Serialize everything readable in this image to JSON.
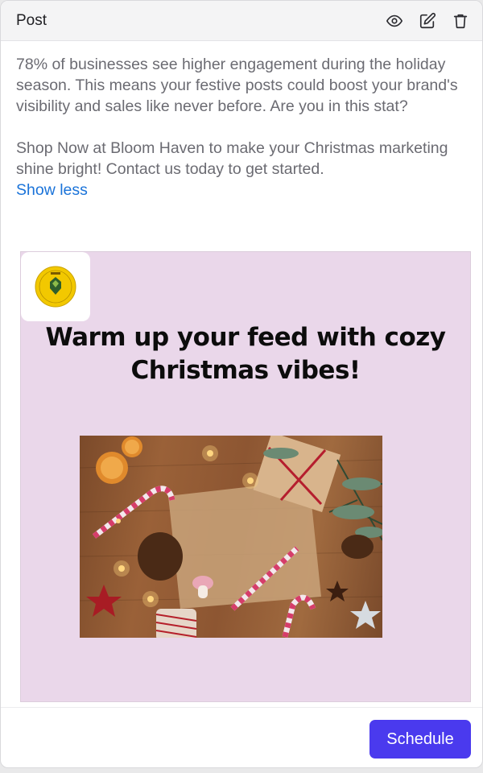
{
  "header": {
    "title": "Post",
    "icons": [
      "eye-icon",
      "edit-icon",
      "trash-icon"
    ]
  },
  "post": {
    "paragraph_1": "78% of businesses see higher engagement during the holiday season. This means your festive posts could boost your brand's visibility and sales like never before. Are you in this stat?",
    "paragraph_2": "Shop Now at Bloom Haven to make your Christmas marketing shine bright! Contact us today to get started.",
    "toggle_label": "Show less"
  },
  "creative": {
    "headline": "Warm up your feed with cozy Christmas vibes!",
    "logo_text": "Bloom Haven",
    "background_color": "#ead7ea"
  },
  "footer": {
    "schedule_label": "Schedule"
  },
  "colors": {
    "accent": "#4a3aee",
    "link": "#1a73d9"
  }
}
